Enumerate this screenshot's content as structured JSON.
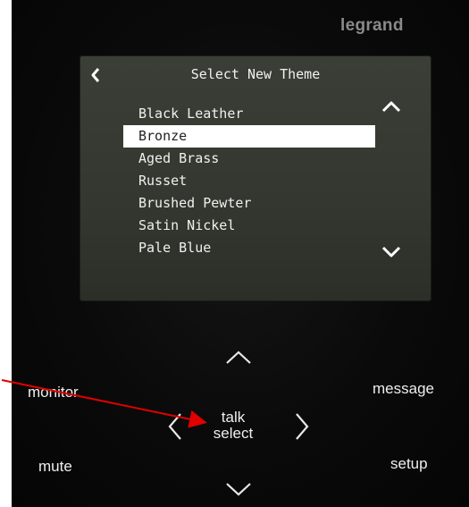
{
  "brand": "legrand",
  "screen": {
    "title": "Select New Theme",
    "back_icon": "chevron-left-icon",
    "themes": [
      "Black Leather",
      "Bronze",
      "Aged Brass",
      "Russet",
      "Brushed Pewter",
      "Satin Nickel",
      "Pale Blue"
    ],
    "selected_index": 1,
    "scroll_up_icon": "chevron-up-icon",
    "scroll_down_icon": "chevron-down-icon"
  },
  "buttons": {
    "monitor": "monitor",
    "message": "message",
    "mute": "mute",
    "setup": "setup",
    "talk": "talk",
    "select": "select"
  },
  "colors": {
    "screen_bg": "#34372f",
    "selection": "#ffffff",
    "annotation_arrow": "#e00000"
  }
}
